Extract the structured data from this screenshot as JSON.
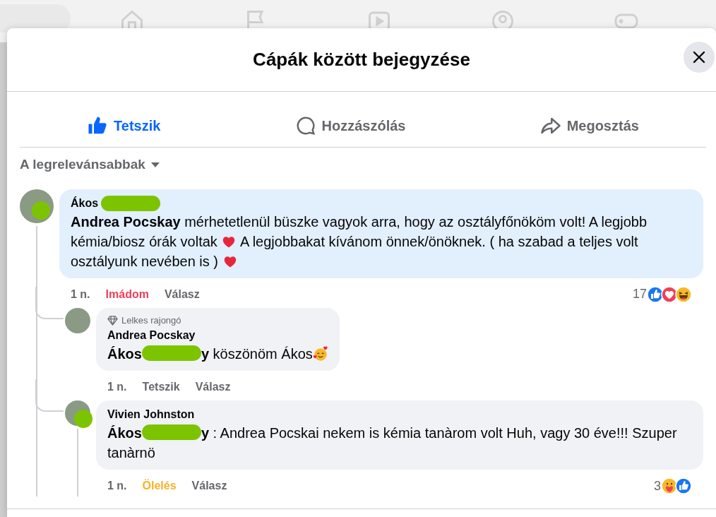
{
  "dialog": {
    "title": "Cápák között bejegyzése"
  },
  "actions": [
    {
      "label": "Tetszik",
      "kind": "like",
      "selected": true
    },
    {
      "label": "Hozzászólás",
      "kind": "comment",
      "selected": false
    },
    {
      "label": "Megosztás",
      "kind": "share",
      "selected": false
    }
  ],
  "sort": {
    "label": "A legrelevánsabbak"
  },
  "comments": [
    {
      "author": "Ákos",
      "author_redacted": true,
      "avatar_redacted": true,
      "highlighted": true,
      "body": [
        {
          "kind": "mention",
          "text": "Andrea Pocskay"
        },
        {
          "kind": "text",
          "text": " mérhetetlenül büszke vagyok arra, hogy az osztályfőnököm volt! A legjobb kémia/biosz órák voltak "
        },
        {
          "kind": "heart"
        },
        {
          "kind": "text",
          "text": " A legjobbakat kívánom önnek/önöknek. ( ha szabad a teljes volt osztályunk nevében is ) "
        },
        {
          "kind": "heart"
        }
      ],
      "time": "1 n.",
      "reaction": {
        "label": "Imádom",
        "kind": "love"
      },
      "reply_label": "Válasz",
      "reaction_count": "17",
      "reactions": [
        {
          "kind": "like"
        },
        {
          "kind": "love"
        },
        {
          "kind": "haha"
        }
      ],
      "replies": [
        {
          "badge": "Lelkes rajongó",
          "author": "Andrea Pocskay",
          "author_redacted": false,
          "avatar_redacted": false,
          "highlighted": false,
          "has_more_replies": false,
          "body": [
            {
              "kind": "mention",
              "text": "Ákos"
            },
            {
              "kind": "redaction"
            },
            {
              "kind": "mention",
              "text": "y"
            },
            {
              "kind": "text",
              "text": " köszönöm Ákos"
            },
            {
              "kind": "hearts-face"
            }
          ],
          "time": "1 n.",
          "reaction": {
            "label": "Tetszik",
            "kind": "none"
          },
          "reply_label": "Válasz"
        },
        {
          "author": "Vivien Johnston",
          "author_redacted": false,
          "avatar_redacted": true,
          "highlighted": false,
          "has_more_replies": true,
          "body": [
            {
              "kind": "mention",
              "text": "Ákos"
            },
            {
              "kind": "redaction"
            },
            {
              "kind": "mention",
              "text": "y"
            },
            {
              "kind": "text",
              "text": " : Andrea Pocskai nekem is kémia tanàrom volt Huh, vagy 30 éve!!! Szuper tanàrnö"
            }
          ],
          "time": "1 n.",
          "reaction": {
            "label": "Ölelés",
            "kind": "care"
          },
          "reply_label": "Válasz",
          "reaction_count": "3",
          "reactions": [
            {
              "kind": "care"
            },
            {
              "kind": "like"
            }
          ]
        }
      ]
    }
  ]
}
